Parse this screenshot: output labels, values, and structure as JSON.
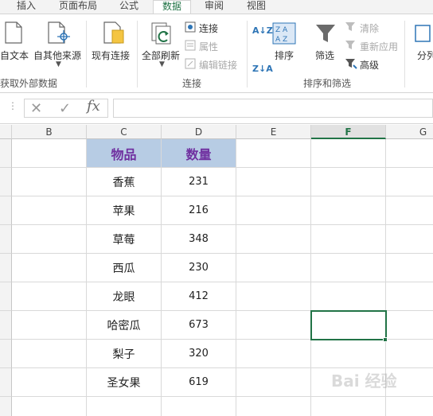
{
  "tabs": [
    {
      "label": "插入",
      "active": false
    },
    {
      "label": "页面布局",
      "active": false
    },
    {
      "label": "公式",
      "active": false
    },
    {
      "label": "数据",
      "active": true
    },
    {
      "label": "审阅",
      "active": false
    },
    {
      "label": "视图",
      "active": false
    }
  ],
  "ribbon": {
    "get_data": {
      "group_label": "获取外部数据",
      "from_text": "自文本",
      "from_other": "自其他来源",
      "existing_conn": "现有连接"
    },
    "connections": {
      "group_label": "连接",
      "refresh_all": "全部刷新",
      "connections": "连接",
      "properties": "属性",
      "edit_links": "编辑链接"
    },
    "sort_filter": {
      "group_label": "排序和筛选",
      "sort": "排序",
      "filter": "筛选",
      "clear": "清除",
      "reapply": "重新应用",
      "advanced": "高级"
    },
    "partial_next": "分列"
  },
  "formula_bar": {
    "fx": "fx",
    "value": ""
  },
  "columns": [
    "B",
    "C",
    "D",
    "E",
    "F",
    "G"
  ],
  "selected_column": "F",
  "table": {
    "header": [
      "物品",
      "数量"
    ],
    "rows": [
      [
        "香蕉",
        "231"
      ],
      [
        "苹果",
        "216"
      ],
      [
        "草莓",
        "348"
      ],
      [
        "西瓜",
        "230"
      ],
      [
        "龙眼",
        "412"
      ],
      [
        "哈密瓜",
        "673"
      ],
      [
        "梨子",
        "320"
      ],
      [
        "圣女果",
        "619"
      ]
    ]
  },
  "active_cell": "F7",
  "watermark": "Bai 经验",
  "colors": {
    "accent": "#217346",
    "header_fill": "#b7cce4",
    "header_text": "#7030a0"
  }
}
